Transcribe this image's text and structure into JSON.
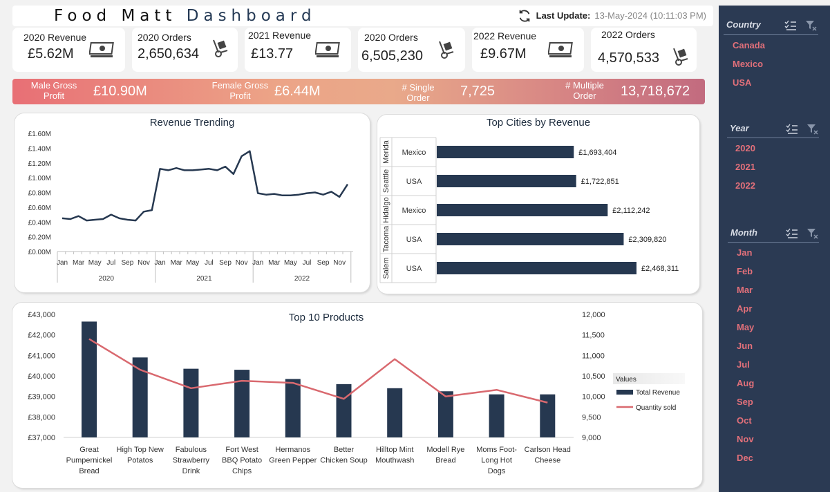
{
  "header": {
    "title_part1": "Food Matt",
    "title_part2": "Dashboard",
    "last_update_label": "Last Update:",
    "last_update_value": "13-May-2024 (10:11:03 PM)"
  },
  "kpis": [
    {
      "label": "2020 Revenue",
      "value": "£5.62M",
      "icon": "money-icon"
    },
    {
      "label": "2020 Orders",
      "value": "2,650,634",
      "icon": "hand-truck-icon"
    },
    {
      "label": "2021 Revenue",
      "value": "£13.77",
      "icon": "money-icon"
    },
    {
      "label": "2020 Orders",
      "value": "6,505,230",
      "icon": "hand-truck-icon"
    },
    {
      "label": "2022 Revenue",
      "value": "£9.67M",
      "icon": "money-icon"
    },
    {
      "label": "2022 Orders",
      "value": "4,570,533",
      "icon": "hand-truck-icon"
    }
  ],
  "band": {
    "male_label_1": "Male Gross",
    "male_label_2": "Profit",
    "male_value": "£10.90M",
    "female_label_1": "Female Gross",
    "female_label_2": "Profit",
    "female_value": "£6.44M",
    "single_label_1": "# Single",
    "single_label_2": "Order",
    "single_value": "7,725",
    "multi_label_1": "# Multiple",
    "multi_label_2": "Order",
    "multi_value": "13,718,672"
  },
  "revenue_trend": {
    "title": "Revenue Trending",
    "y_ticks": [
      "£0.00M",
      "£0.20M",
      "£0.40M",
      "£0.60M",
      "£0.80M",
      "£1.00M",
      "£1.20M",
      "£1.40M",
      "£1.60M"
    ],
    "month_ticks": [
      "Jan",
      "Mar",
      "May",
      "Jul",
      "Sep",
      "Nov"
    ],
    "years": [
      "2020",
      "2021",
      "2022"
    ]
  },
  "top_cities": {
    "title": "Top Cities by Revenue",
    "rows": [
      {
        "city": "Merida",
        "country": "Mexico",
        "value_label": "£1,693,404"
      },
      {
        "city": "Seattle",
        "country": "USA",
        "value_label": "£1,722,851"
      },
      {
        "city": "Hidalgo",
        "country": "Mexico",
        "value_label": "£2,112,242"
      },
      {
        "city": "Tacoma",
        "country": "USA",
        "value_label": "£2,309,820"
      },
      {
        "city": "Salem",
        "country": "USA",
        "value_label": "£2,468,311"
      }
    ]
  },
  "top_products": {
    "title": "Top 10 Products",
    "left_ticks": [
      "£37,000",
      "£38,000",
      "£39,000",
      "£40,000",
      "£41,000",
      "£42,000",
      "£43,000"
    ],
    "right_ticks": [
      "9,000",
      "9,500",
      "10,000",
      "10,500",
      "11,000",
      "11,500",
      "12,000"
    ],
    "legend_title": "Values",
    "legend_bar": "Total Revenue",
    "legend_line": "Quantity sold",
    "product_lines": [
      [
        "Great",
        "Pumpernickel",
        "Bread"
      ],
      [
        "High Top New",
        "Potatos"
      ],
      [
        "Fabulous",
        "Strawberry",
        "Drink"
      ],
      [
        "Fort West",
        "BBQ Potato",
        "Chips"
      ],
      [
        "Hermanos",
        "Green Pepper"
      ],
      [
        "Better",
        "Chicken Soup"
      ],
      [
        "Hilltop Mint",
        "Mouthwash"
      ],
      [
        "Modell Rye",
        "Bread"
      ],
      [
        "Moms Foot-",
        "Long Hot",
        "Dogs"
      ],
      [
        "Carlson Head",
        "Cheese"
      ]
    ]
  },
  "slicers": [
    {
      "title": "Country",
      "items": [
        "Canada",
        "Mexico",
        "USA"
      ]
    },
    {
      "title": "Year",
      "items": [
        "2020",
        "2021",
        "2022"
      ]
    },
    {
      "title": "Month",
      "items": [
        "Jan",
        "Feb",
        "Mar",
        "Apr",
        "May",
        "Jun",
        "Jul",
        "Aug",
        "Sep",
        "Oct",
        "Nov",
        "Dec"
      ]
    }
  ],
  "colors": {
    "navy": "#263850",
    "accent": "#e2707a",
    "line_red": "#d9696f"
  },
  "chart_data": [
    {
      "type": "line",
      "title": "Revenue Trending",
      "x": [
        "Jan 2020",
        "Feb 2020",
        "Mar 2020",
        "Apr 2020",
        "May 2020",
        "Jun 2020",
        "Jul 2020",
        "Aug 2020",
        "Sep 2020",
        "Oct 2020",
        "Nov 2020",
        "Dec 2020",
        "Jan 2021",
        "Feb 2021",
        "Mar 2021",
        "Apr 2021",
        "May 2021",
        "Jun 2021",
        "Jul 2021",
        "Aug 2021",
        "Sep 2021",
        "Oct 2021",
        "Nov 2021",
        "Dec 2021",
        "Jan 2022",
        "Feb 2022",
        "Mar 2022",
        "Apr 2022",
        "May 2022",
        "Jun 2022",
        "Jul 2022",
        "Aug 2022",
        "Sep 2022",
        "Oct 2022",
        "Nov 2022",
        "Dec 2022"
      ],
      "series": [
        {
          "values": [
            0.45,
            0.44,
            0.48,
            0.42,
            0.43,
            0.44,
            0.5,
            0.45,
            0.43,
            0.42,
            0.54,
            0.56,
            1.12,
            1.1,
            1.13,
            1.1,
            1.1,
            1.11,
            1.12,
            1.1,
            1.15,
            1.05,
            1.29,
            1.36,
            0.79,
            0.77,
            0.78,
            0.76,
            0.76,
            0.77,
            0.79,
            0.8,
            0.77,
            0.81,
            0.74,
            0.91
          ]
        }
      ],
      "ylim": [
        0,
        1.6
      ],
      "grid": false
    },
    {
      "type": "bar",
      "orientation": "horizontal",
      "title": "Top Cities by Revenue",
      "categories": [
        "Merida",
        "Seattle",
        "Hidalgo",
        "Tacoma",
        "Salem"
      ],
      "values": [
        1693404,
        1722851,
        2112242,
        2309820,
        2468311
      ]
    },
    {
      "type": "bar",
      "title": "Top 10 Products",
      "categories": [
        "Great Pumpernickel Bread",
        "High Top New Potatos",
        "Fabulous Strawberry Drink",
        "Fort West BBQ Potato Chips",
        "Hermanos Green Pepper",
        "Better Chicken Soup",
        "Hilltop Mint Mouthwash",
        "Modell Rye Bread",
        "Moms Foot-Long Hot Dogs",
        "Carlson Head Cheese"
      ],
      "series": [
        {
          "name": "Total Revenue",
          "type": "bar",
          "axis": "left",
          "values": [
            42650,
            40900,
            40350,
            40300,
            39850,
            39600,
            39400,
            39250,
            39100,
            39100
          ]
        },
        {
          "name": "Quantity sold",
          "type": "line",
          "axis": "right",
          "values": [
            11400,
            10650,
            10200,
            10380,
            10330,
            9940,
            10910,
            10000,
            10160,
            9850
          ]
        }
      ],
      "ylim_left": [
        37000,
        43000
      ],
      "ylim_right": [
        9000,
        12000
      ],
      "legend": "right"
    }
  ]
}
